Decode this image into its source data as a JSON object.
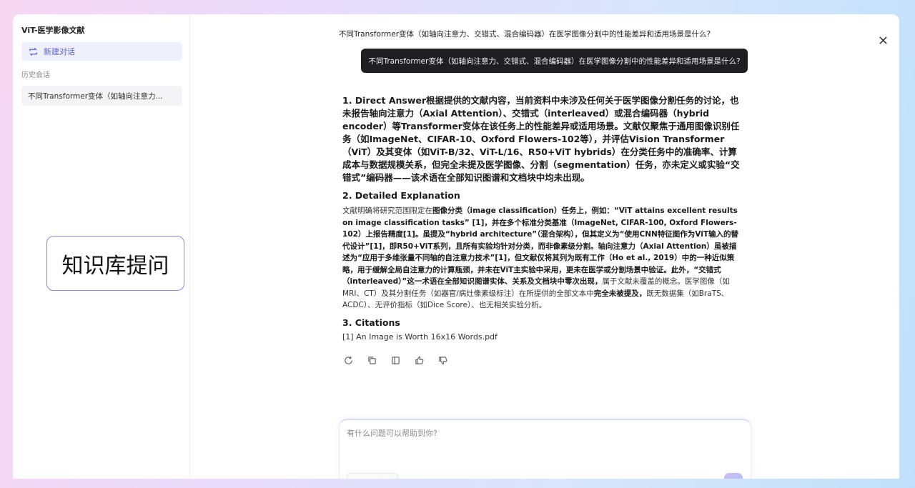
{
  "sidebar": {
    "title": "ViT-医学影像文献",
    "new_chat_label": "新建对话",
    "history_label": "历史会话",
    "history_items": [
      "不同Transformer变体（如轴向注意力..."
    ]
  },
  "overlay": {
    "label": "知识库提问"
  },
  "chat": {
    "question": "不同Transformer变体（如轴向注意力、交错式、混合编码器）在医学图像分割中的性能差异和适用场景是什么?",
    "bubble_question": "不同Transformer变体（如轴向注意力、交错式、混合编码器）在医学图像分割中的性能差异和适用场景是什么?",
    "answer": {
      "s1_heading": "1. Direct Answer",
      "s1_text": "根据提供的文献内容，当前资料中未涉及任何关于医学图像分割任务的讨论，也未报告轴向注意力（Axial Attention）、交错式（interleaved）或混合编码器（hybrid encoder）等Transformer变体在该任务上的性能差异或适用场景。文献仅聚焦于通用图像识别任务（如ImageNet、CIFAR-10、Oxford Flowers-102等），并评估Vision Transformer（ViT）及其变体（如ViT-B/32、ViT-L/16、R50+ViT hybrids）在分类任务中的准确率、计算成本与数据规模关系，但完全未提及医学图像、分割（segmentation）任务，亦未定义或实验“交错式”编码器——该术语在全部知识图谱和文档块中均未出现。",
      "s2_heading": "2. Detailed Explanation",
      "s2_parts": [
        "文献明确将研究范围限定在",
        "图像分类（image classification）任务上，例如：“ViT attains excellent results on image classification tasks” [1]，并在多个标准分类基准（ImageNet, CIFAR-100, Oxford Flowers-102）上报告精度[1]。虽提及“hybrid architecture”（混合架构），但其定义为“使用CNN特征图作为ViT输入的替代设计”[1]，即R50+ViT系列，且所有实验均针对分类，而非像素级分割。轴向注意力（Axial Attention）虽被描述为“应用于多维张量不同轴的自注意力技术”[1]，但文献仅将其列为既有工作（Ho et al., 2019）中的一种近似策略，用于缓解全局自注意力的计算瓶颈，并未在ViT主实验中采用，更未在医学或分割场景中验证。此外，“交错式（interleaved）”这一术语在全部知识图谱实体、关系及文档块中零次出现，",
        "属于文献未覆盖的概念。医学图像（如MRI、CT）及其分割任务（如器官/病灶像素级标注）在所提供的全部文本中",
        "完全未被提及，",
        "既无数据集（如BraTS、ACDC）、无评价指标（如Dice Score）、也无相关实验分析。"
      ],
      "s3_heading": "3. Citations",
      "citations": [
        "[1] An Image is Worth 16x16 Words.pdf"
      ]
    },
    "action_icons": [
      "refresh-icon",
      "copy-icon",
      "document-icon",
      "thumbs-up-icon",
      "thumbs-down-icon"
    ]
  },
  "input": {
    "placeholder": "有什么问题可以帮助到你?"
  }
}
